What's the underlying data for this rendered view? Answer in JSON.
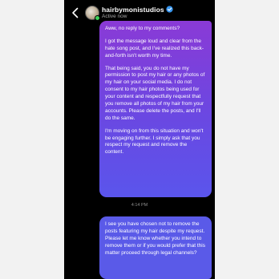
{
  "header": {
    "username": "hairbymonistudios",
    "status": "Active now",
    "back_icon": "chevron-left-icon",
    "verified_icon": "verified-badge-icon"
  },
  "colors": {
    "background": "#000000",
    "bubble_gradient_top": "#8a3ad6",
    "bubble_gradient_bottom": "#5a55ec",
    "active_dot": "#3ed15a",
    "verified": "#3897f0"
  },
  "messages": [
    {
      "paragraphs": [
        "Aww, no reply to my comments?",
        "I got the message loud and clear from the hate song post, and I've realized this back-and-forth isn't worth my time.",
        "That being said, you do not have my permission to post my hair or any photos of my hair on your social media. I do not consent to my hair photos being used for your content and respectfully request that you remove all photos of my hair from your accounts. Please delete the posts, and I'll do the same.",
        "I'm moving on from this situation and won't be engaging further. I simply ask that you respect my request and remove the content."
      ]
    },
    {
      "paragraphs": [
        "I see you have chosen not to remove the posts featuring my hair despite my request. Please let me know whether you intend to remove them or if you would prefer that this matter proceed through legal channels?"
      ]
    }
  ],
  "timestamp": "4:14 PM"
}
